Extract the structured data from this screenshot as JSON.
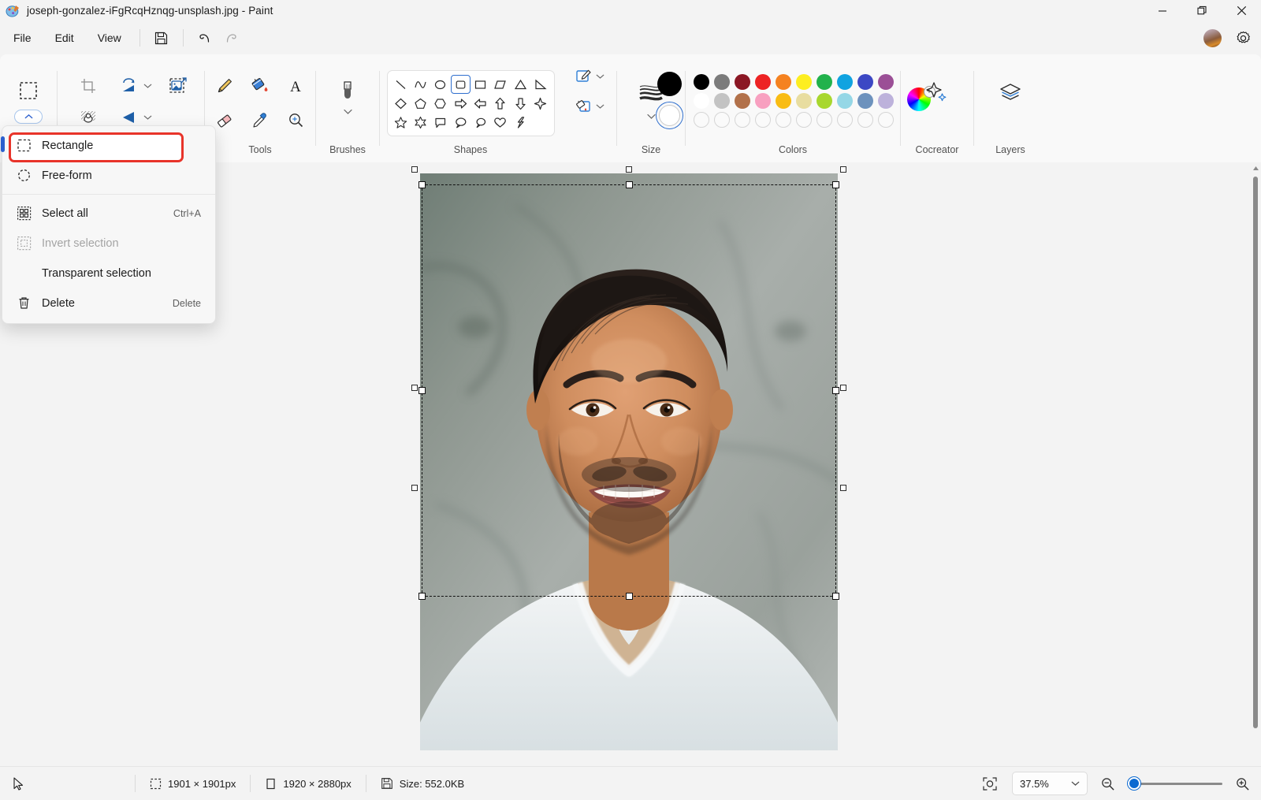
{
  "window": {
    "title": "joseph-gonzalez-iFgRcqHznqg-unsplash.jpg - Paint",
    "app_icon": "paint-palette-icon",
    "controls": {
      "minimize": "minimize-icon",
      "maximize": "restore-icon",
      "close": "close-icon"
    }
  },
  "menubar": {
    "items": [
      {
        "label": "File"
      },
      {
        "label": "Edit"
      },
      {
        "label": "View"
      }
    ],
    "quick_actions": [
      {
        "name": "save-icon",
        "enabled": true
      },
      {
        "name": "undo-icon",
        "enabled": true
      },
      {
        "name": "redo-icon",
        "enabled": false
      }
    ],
    "account_avatar": "user-avatar",
    "settings": "gear-icon"
  },
  "ribbon": {
    "groups": [
      {
        "label": "",
        "name": "select"
      },
      {
        "label": "",
        "name": "image"
      },
      {
        "label": "Tools",
        "name": "tools"
      },
      {
        "label": "Brushes",
        "name": "brushes"
      },
      {
        "label": "Shapes",
        "name": "shapes"
      },
      {
        "label": "Size",
        "name": "size"
      },
      {
        "label": "Colors",
        "name": "colors"
      },
      {
        "label": "Cocreator",
        "name": "cocreator"
      },
      {
        "label": "Layers",
        "name": "layers"
      }
    ],
    "select": {
      "tool": "rectangle-select-icon",
      "expand": "chevron-up-icon"
    },
    "image": {
      "crop": "crop-icon",
      "rotate": "rotate-icon",
      "resize": "resize-image-icon",
      "background_remove": "remove-background-icon",
      "flip": "flip-icon"
    },
    "tools": [
      {
        "name": "pencil-icon"
      },
      {
        "name": "fill-bucket-icon"
      },
      {
        "name": "text-icon"
      },
      {
        "name": "eraser-icon"
      },
      {
        "name": "eyedropper-icon"
      },
      {
        "name": "magnifier-icon"
      }
    ],
    "brushes": {
      "icon": "brush-icon",
      "expand": "chevron-down-icon"
    },
    "shapes": {
      "selected_index": 3,
      "items": [
        "line",
        "curve",
        "oval",
        "rounded-rectangle",
        "rectangle",
        "parallelogram",
        "triangle",
        "right-triangle",
        "diamond",
        "pentagon",
        "hexagon",
        "arrow-right",
        "arrow-left",
        "arrow-up",
        "arrow-down",
        "four-point-star",
        "five-point-star",
        "six-point-star",
        "rounded-callout",
        "oval-callout",
        "cloud-callout",
        "heart",
        "lightning"
      ],
      "outline_label": "outline-icon",
      "fill_label": "fill-icon"
    },
    "size": {
      "icon": "size-lines-icon",
      "expand": "chevron-down-icon"
    },
    "colors": {
      "primary": "#000000",
      "secondary": "#ffffff",
      "row1": [
        "#000000",
        "#7b7b7b",
        "#8b1724",
        "#ed2324",
        "#f58220",
        "#fdee21",
        "#22b24c",
        "#10a3e0",
        "#3c48c4",
        "#9b4f96"
      ],
      "row2": [
        "#ffffff",
        "#c3c3c3",
        "#b2714a",
        "#f8a0c0",
        "#f9bc14",
        "#e8dda0",
        "#a8d72e",
        "#95d7e6",
        "#6d92bd",
        "#bdb2db"
      ],
      "row3_empty_count": 10,
      "wheel": "color-wheel-icon",
      "add": "add-color-icon"
    },
    "cocreator": {
      "icon": "sparkle-icon"
    },
    "layers": {
      "icon": "layers-icon"
    }
  },
  "dropdown": {
    "name": "selection-menu",
    "items": [
      {
        "label": "Rectangle",
        "icon": "rectangle-select-icon",
        "accel": "",
        "enabled": true,
        "selected": true,
        "highlighted": true
      },
      {
        "label": "Free-form",
        "icon": "freeform-select-icon",
        "accel": "",
        "enabled": true,
        "selected": false,
        "highlighted": false
      },
      {
        "label": "Select all",
        "icon": "select-all-icon",
        "accel": "Ctrl+A",
        "enabled": true,
        "selected": false,
        "highlighted": false
      },
      {
        "label": "Invert selection",
        "icon": "invert-selection-icon",
        "accel": "",
        "enabled": false,
        "selected": false,
        "highlighted": false
      },
      {
        "label": "Transparent selection",
        "icon": "",
        "accel": "",
        "enabled": true,
        "selected": false,
        "highlighted": false
      },
      {
        "label": "Delete",
        "icon": "trash-icon",
        "accel": "Delete",
        "enabled": true,
        "selected": false,
        "highlighted": false
      }
    ],
    "highlight_color": "#e8342a"
  },
  "canvas": {
    "image_alt": "portrait-photo",
    "selection_active": true
  },
  "statusbar": {
    "cursor_icon": "cursor-arrow-icon",
    "selection_size": "1901 × 1901px",
    "selection_icon": "selection-size-icon",
    "image_size": "1920 × 2880px",
    "image_icon": "image-size-icon",
    "file_size": "Size: 552.0KB",
    "file_icon": "save-disk-icon",
    "fit_icon": "fit-to-window-icon",
    "zoom_value": "37.5%",
    "zoom_chevron": "chevron-down-icon",
    "zoom_out_icon": "zoom-out-icon",
    "zoom_in_icon": "zoom-in-icon"
  }
}
